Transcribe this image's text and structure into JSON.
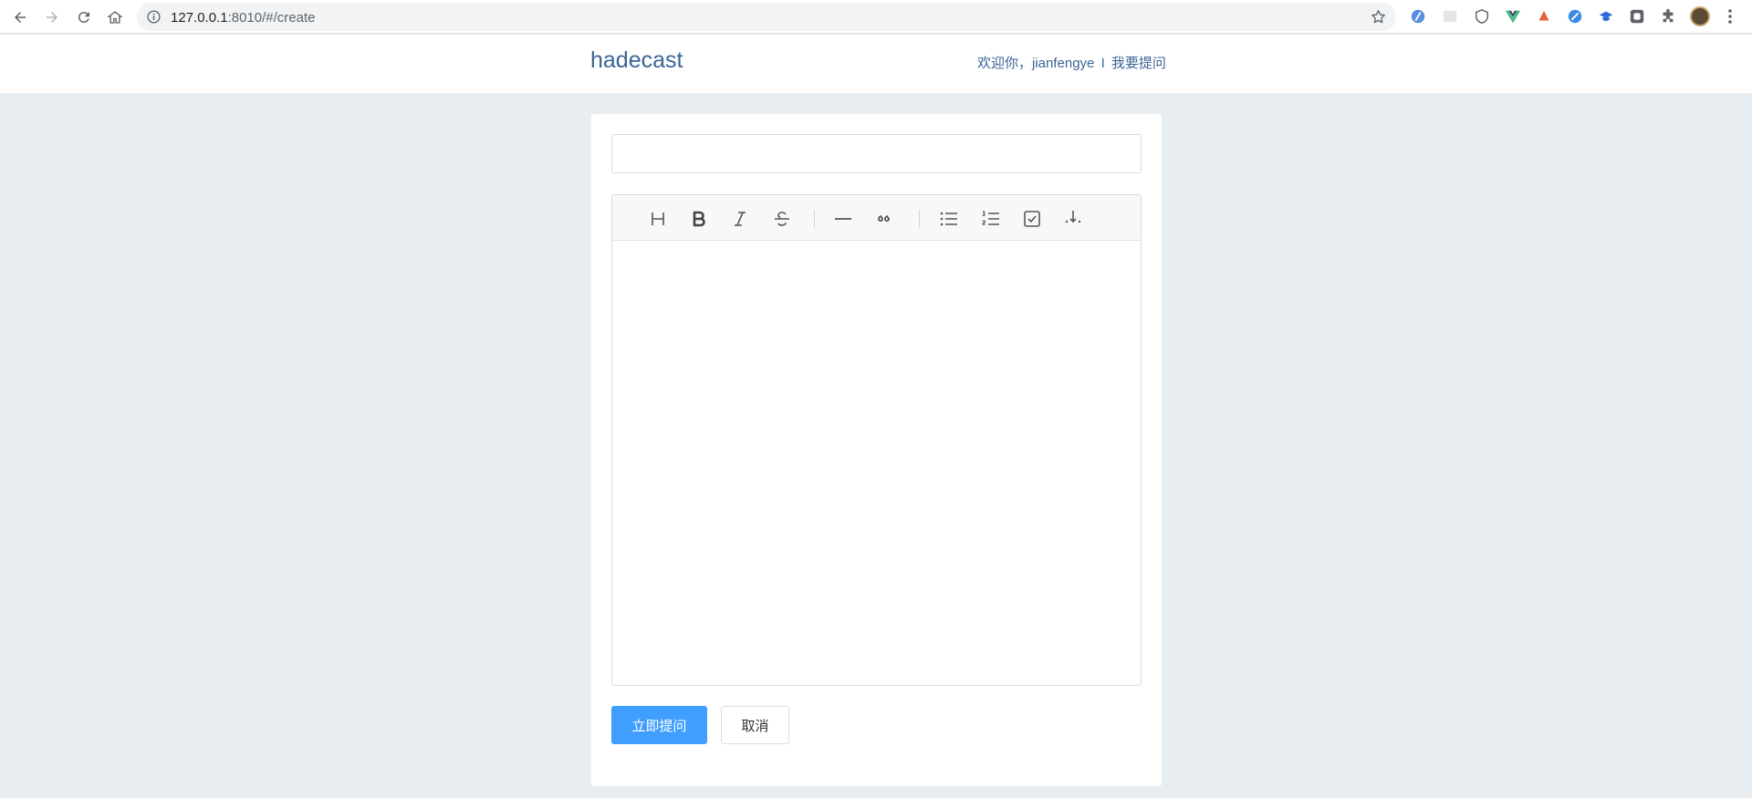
{
  "browser": {
    "url_host": "127.0.0.1",
    "url_rest": ":8010/#/create",
    "icons": [
      "back-icon",
      "forward-icon",
      "reload-icon",
      "home-icon",
      "info-icon",
      "bookmark-star-icon",
      "extensions-icon",
      "menu-icon"
    ]
  },
  "header": {
    "logo": "hadecast",
    "welcome": "欢迎你，jianfengye",
    "separator": "I",
    "ask_link": "我要提问"
  },
  "form": {
    "title_value": "",
    "title_placeholder": "",
    "editor_content": "",
    "toolbar": [
      "heading-icon",
      "bold-icon",
      "italic-icon",
      "strikethrough-icon",
      "horizontal-rule-icon",
      "quote-icon",
      "bullet-list-icon",
      "ordered-list-icon",
      "task-list-icon",
      "split-preview-icon"
    ],
    "submit_label": "立即提问",
    "cancel_label": "取消"
  },
  "colors": {
    "brand": "#3c6496",
    "primary_button": "#409eff",
    "page_background": "#e8edf2"
  }
}
